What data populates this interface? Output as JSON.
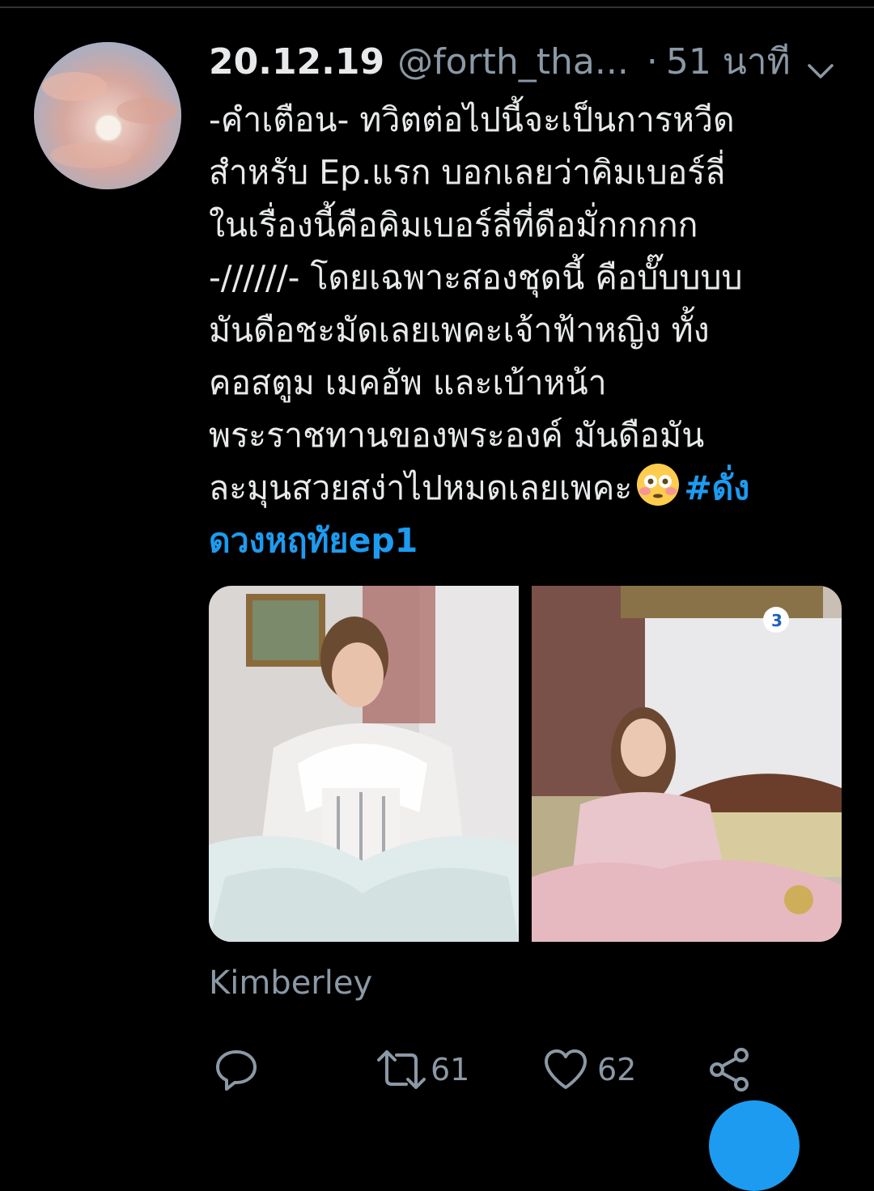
{
  "tweet": {
    "date": "20.12.19",
    "handle": "@forth_tha...",
    "separator": "·",
    "time": "51 นาที",
    "text_lines": [
      "-คำเตือน- ทวิตต่อไปนี้จะเป็นการหวีด",
      "สำหรับ Ep.แรก บอกเลยว่าคิมเบอร์ลี่",
      "ในเรื่องนี้คือคิมเบอร์ลี่ที่ดือมั่กกกกก",
      "-//////- โดยเฉพาะสองชุดนี้ คือบั๊บบบบ",
      "มันดือชะมัดเลยเพคะเจ้าฟ้าหญิง ทั้ง",
      "คอสตูม เมคอัพ และเบ้าหน้า",
      "พระราชทานของพระองค์ มันดือมัน"
    ],
    "last_line_text": "ละมุนสวยสง่าไปหมดเลยเพคะ",
    "emoji": "flushed-face",
    "hashtag_part1": "#ดั่ง",
    "hashtag_part2": "ดวงหฤทัยep1",
    "media_caption": "Kimberley",
    "replies": "",
    "retweets": "61",
    "likes": "62"
  },
  "colors": {
    "background": "#000000",
    "text": "#e7e9ea",
    "muted": "#8b98a5",
    "accent": "#1d9bf0"
  },
  "icons": {
    "menu": "chevron-down-icon",
    "reply": "reply-icon",
    "retweet": "retweet-icon",
    "like": "heart-icon",
    "share": "share-icon"
  }
}
